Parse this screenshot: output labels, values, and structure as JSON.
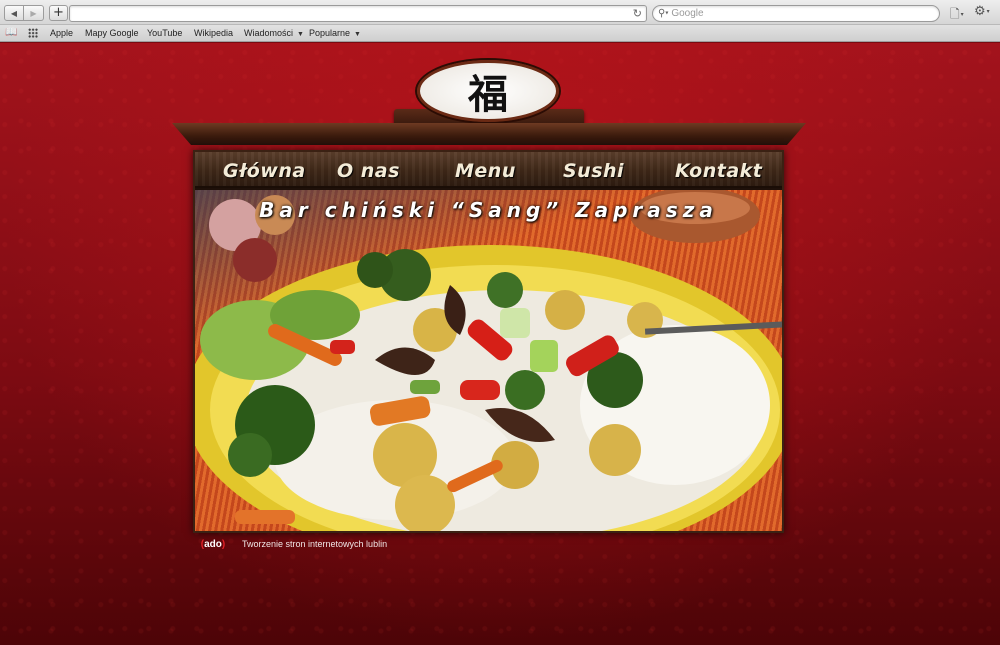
{
  "browser": {
    "search_placeholder": "Google",
    "bookmarks": [
      {
        "label": "Apple"
      },
      {
        "label": "Mapy Google"
      },
      {
        "label": "YouTube"
      },
      {
        "label": "Wikipedia"
      },
      {
        "label": "Wiadomości",
        "dropdown": true
      },
      {
        "label": "Popularne",
        "dropdown": true
      }
    ],
    "icons": {
      "back": "back-arrow-icon",
      "forward": "forward-arrow-icon",
      "new_tab": "plus-icon",
      "reload": "reload-icon",
      "search": "magnifier-icon",
      "page_menu": "page-icon",
      "settings": "gear-icon",
      "reading_list": "book-icon",
      "top_sites": "grid-icon"
    }
  },
  "site": {
    "emblem_char": "福",
    "menu": [
      "Główna",
      "O nas",
      "Menu",
      "Sushi",
      "Kontakt"
    ],
    "hero_title": "Bar chiński “Sang” Zaprasza",
    "footer_logo": "ado",
    "footer_text": "Tworzenie stron internetowych lublin",
    "colors": {
      "page_red": "#8e0f16",
      "menu_wood": "#4a2f1d",
      "menu_text": "#f4ecd8"
    }
  }
}
